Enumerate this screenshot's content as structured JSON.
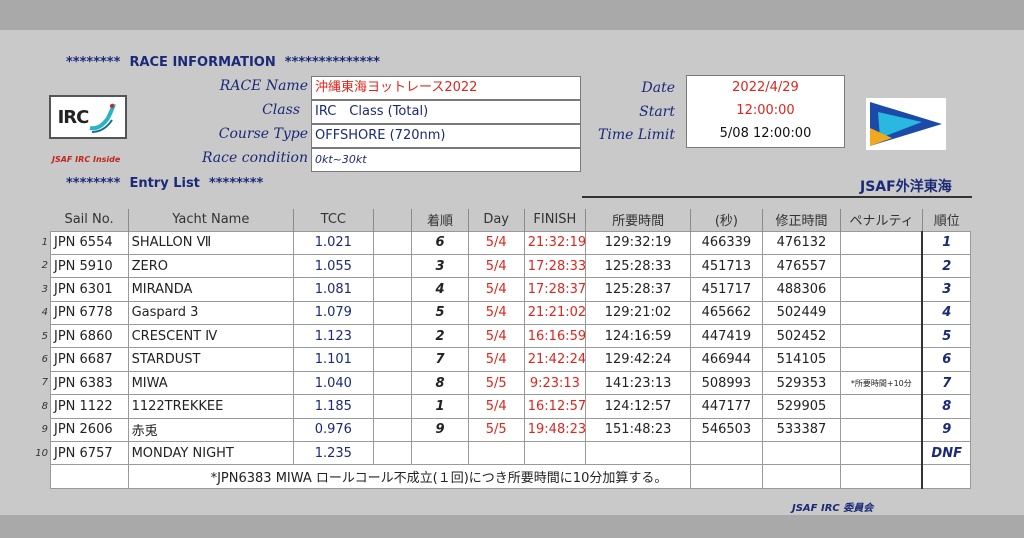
{
  "header": {
    "race_info_title": "********  RACE INFORMATION  **************",
    "entry_list_title": "********  Entry List  ********",
    "org_name": "JSAF外洋東海",
    "irc_logo_text": "IRC",
    "irc_inside": "JSAF IRC Inside",
    "footer": "JSAF IRC 委員会"
  },
  "race": {
    "race_name_label": "RACE Name",
    "race_name": "沖縄東海ヨットレース2022",
    "class_label": "Class",
    "class": "IRC　Class (Total)",
    "course_label": "Course Type",
    "course": "OFFSHORE (720nm)",
    "condition_label": "Race condition",
    "condition": "0kt~30kt",
    "date_label": "Date",
    "date": "2022/4/29",
    "start_label": "Start",
    "start": "12:00:00",
    "limit_label": "Time Limit",
    "limit": "5/08 12:00:00"
  },
  "table": {
    "columns": [
      "Sail No.",
      "Yacht Name",
      "TCC",
      "",
      "着順",
      "Day",
      "FINISH",
      "所要時間",
      "(秒)",
      "修正時間",
      "ペナルティ",
      "順位"
    ],
    "rows": [
      {
        "n": "1",
        "sail": "JPN 6554",
        "name": "SHALLON Ⅶ",
        "tcc": "1.021",
        "blank": "",
        "order": "6",
        "day": "5/4",
        "finish": "21:32:19",
        "elapsed": "129:32:19",
        "sec": "466339",
        "corr": "476132",
        "pen": "",
        "rank": "1"
      },
      {
        "n": "2",
        "sail": "JPN 5910",
        "name": "ZERO",
        "tcc": "1.055",
        "blank": "",
        "order": "3",
        "day": "5/4",
        "finish": "17:28:33",
        "elapsed": "125:28:33",
        "sec": "451713",
        "corr": "476557",
        "pen": "",
        "rank": "2"
      },
      {
        "n": "3",
        "sail": "JPN 6301",
        "name": "MIRANDA",
        "tcc": "1.081",
        "blank": "",
        "order": "4",
        "day": "5/4",
        "finish": "17:28:37",
        "elapsed": "125:28:37",
        "sec": "451717",
        "corr": "488306",
        "pen": "",
        "rank": "3"
      },
      {
        "n": "4",
        "sail": "JPN 6778",
        "name": "Gaspard 3",
        "tcc": "1.079",
        "blank": "",
        "order": "5",
        "day": "5/4",
        "finish": "21:21:02",
        "elapsed": "129:21:02",
        "sec": "465662",
        "corr": "502449",
        "pen": "",
        "rank": "4"
      },
      {
        "n": "5",
        "sail": "JPN 6860",
        "name": "CRESCENT Ⅳ",
        "tcc": "1.123",
        "blank": "",
        "order": "2",
        "day": "5/4",
        "finish": "16:16:59",
        "elapsed": "124:16:59",
        "sec": "447419",
        "corr": "502452",
        "pen": "",
        "rank": "5"
      },
      {
        "n": "6",
        "sail": "JPN 6687",
        "name": "STARDUST",
        "tcc": "1.101",
        "blank": "",
        "order": "7",
        "day": "5/4",
        "finish": "21:42:24",
        "elapsed": "129:42:24",
        "sec": "466944",
        "corr": "514105",
        "pen": "",
        "rank": "6"
      },
      {
        "n": "7",
        "sail": "JPN 6383",
        "name": "MIWA",
        "tcc": "1.040",
        "blank": "",
        "order": "8",
        "day": "5/5",
        "finish": "9:23:13",
        "elapsed": "141:23:13",
        "sec": "508993",
        "corr": "529353",
        "pen": "*所要時間+10分",
        "rank": "7"
      },
      {
        "n": "8",
        "sail": "JPN 1122",
        "name": "1122TREKKEE",
        "tcc": "1.185",
        "blank": "",
        "order": "1",
        "day": "5/4",
        "finish": "16:12:57",
        "elapsed": "124:12:57",
        "sec": "447177",
        "corr": "529905",
        "pen": "",
        "rank": "8"
      },
      {
        "n": "9",
        "sail": "JPN 2606",
        "name": "赤兎",
        "tcc": "0.976",
        "blank": "",
        "order": "9",
        "day": "5/5",
        "finish": "19:48:23",
        "elapsed": "151:48:23",
        "sec": "546503",
        "corr": "533387",
        "pen": "",
        "rank": "9"
      },
      {
        "n": "10",
        "sail": "JPN 6757",
        "name": "MONDAY NIGHT",
        "tcc": "1.235",
        "blank": "",
        "order": "",
        "day": "",
        "finish": "",
        "elapsed": "",
        "sec": "",
        "corr": "",
        "pen": "",
        "rank": "DNF"
      }
    ],
    "note": "*JPN6383 MIWA ロールコール不成立(１回)につき所要時間に10分加算する。"
  },
  "colors": {
    "navy": "#1a2a78",
    "red": "#e0241c",
    "background": "#c9c9c9"
  },
  "icons": [
    "irc-logo-icon",
    "jsaf-flag-icon"
  ]
}
